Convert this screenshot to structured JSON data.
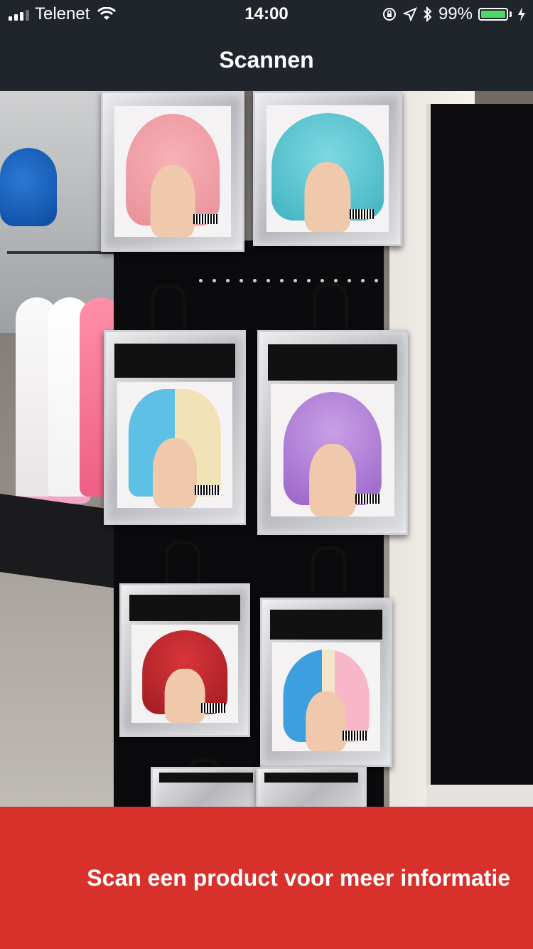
{
  "status_bar": {
    "carrier": "Telenet",
    "time": "14:00",
    "battery_percent": "99%",
    "battery_level": 0.99,
    "icons": [
      "signal-icon",
      "wifi-icon",
      "orientation-lock-icon",
      "location-arrow-icon",
      "bluetooth-icon",
      "battery-icon",
      "charging-bolt-icon"
    ]
  },
  "nav": {
    "title": "Scannen"
  },
  "camera": {
    "description": "camera-viewfinder"
  },
  "info": {
    "message": "Scan een product voor meer informatie"
  },
  "colors": {
    "bar_background": "#20252c",
    "banner": "#d8302a",
    "battery": "#4cd964"
  }
}
